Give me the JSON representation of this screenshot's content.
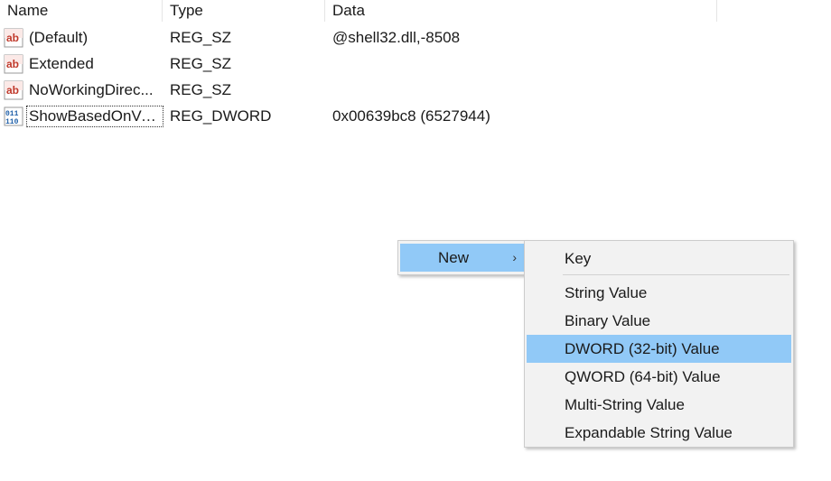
{
  "columns": {
    "name": "Name",
    "type": "Type",
    "data": "Data"
  },
  "rows": [
    {
      "icon": "string-value-icon",
      "name": "(Default)",
      "type": "REG_SZ",
      "data": "@shell32.dll,-8508"
    },
    {
      "icon": "string-value-icon",
      "name": "Extended",
      "type": "REG_SZ",
      "data": ""
    },
    {
      "icon": "string-value-icon",
      "name": "NoWorkingDirec...",
      "type": "REG_SZ",
      "data": ""
    },
    {
      "icon": "binary-value-icon",
      "name": "ShowBasedOnVe...",
      "type": "REG_DWORD",
      "data": "0x00639bc8 (6527944)"
    }
  ],
  "context_menu": {
    "new_label": "New",
    "submenu_arrow": "›"
  },
  "submenu": {
    "items": [
      "Key",
      "String Value",
      "Binary Value",
      "DWORD (32-bit) Value",
      "QWORD (64-bit) Value",
      "Multi-String Value",
      "Expandable String Value"
    ],
    "highlighted": "DWORD (32-bit) Value"
  },
  "colors": {
    "highlight": "#91c9f7",
    "menu_bg": "#f2f2f2",
    "icon_red": "#c0392b",
    "icon_blue": "#1f5fa8"
  },
  "icon_glyphs": {
    "string": "ab",
    "binary_top": "011",
    "binary_bottom": "110"
  }
}
